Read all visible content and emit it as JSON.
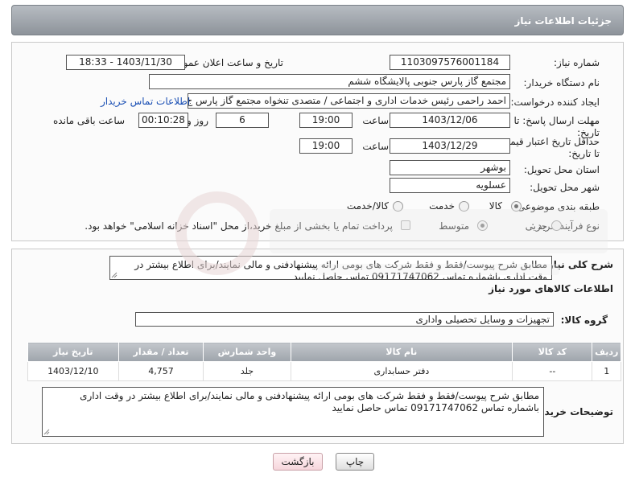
{
  "header": {
    "title": "جزئیات اطلاعات نیاز"
  },
  "form": {
    "need_number": {
      "label": "شماره نیاز:",
      "value": "1103097576001184"
    },
    "announce": {
      "label": "تاریخ و ساعت اعلان عمومی:",
      "value": "1403/11/30 - 18:33"
    },
    "buyer": {
      "label": "نام دستگاه خریدار:",
      "value": "مجتمع گاز پارس جنوبی  پالایشگاه ششم"
    },
    "creator": {
      "label": "ایجاد کننده درخواست:",
      "value": "احمد راحمی رئیس خدمات اداری و اجتماعی / متصدی تنخواه مجتمع گاز پارس ج",
      "link": "اطلاعات تماس خریدار"
    },
    "deadline": {
      "label": "مهلت ارسال پاسخ: تا تاریخ:",
      "date": "1403/12/06",
      "time_label": "ساعت",
      "time": "19:00",
      "days": "6",
      "days_label": "روز و",
      "remaining": "00:10:28",
      "remaining_label": "ساعت باقی مانده"
    },
    "validity": {
      "label": "حداقل تاریخ اعتبار قیمت: تا تاریخ:",
      "date": "1403/12/29",
      "time_label": "ساعت",
      "time": "19:00"
    },
    "province": {
      "label": "استان محل تحویل:",
      "value": "بوشهر"
    },
    "city": {
      "label": "شهر محل تحویل:",
      "value": "عسلویه"
    },
    "category": {
      "label": "طبقه بندی موضوعی:",
      "options": [
        "کالا",
        "خدمت",
        "کالا/خدمت"
      ],
      "selected": "کالا"
    },
    "process": {
      "label": "نوع فرآیند خرید :",
      "options": [
        "جزیی",
        "متوسط"
      ],
      "selected": "متوسط",
      "payment_note": "پرداخت تمام یا بخشی از مبلغ خرید،از محل \"اسناد خزانه اسلامی\" خواهد بود."
    }
  },
  "description": {
    "label": "شرح کلی نیاز:",
    "text": "مطابق شرح پیوست/فقط و فقط شرکت های بومی ارائه پیشنهادفنی و مالی نمایند/برای اطلاع بیشتر در وقت اداری  باشماره تماس 09171747062 تماس حاصل نمایید"
  },
  "goods": {
    "section_title": "اطلاعات کالاهای مورد نیاز",
    "group_label": "گروه کالا:",
    "group_value": "تجهیزات و وسایل تحصیلی واداری",
    "columns": [
      "ردیف",
      "کد کالا",
      "نام کالا",
      "واحد شمارش",
      "تعداد / مقدار",
      "تاریخ نیاز"
    ],
    "rows": [
      [
        "1",
        "--",
        "دفتر حسابداری",
        "جلد",
        "4,757",
        "1403/12/10"
      ]
    ]
  },
  "buyer_notes": {
    "label": "توضیحات خریدار:",
    "text": "مطابق شرح پیوست/فقط و فقط شرکت های بومی ارائه پیشنهادفنی و مالی نمایند/برای اطلاع بیشتر در وقت اداری  باشماره تماس 09171747062 تماس حاصل نمایید"
  },
  "buttons": {
    "print": "چاپ",
    "back": "بازگشت"
  },
  "colors": {
    "header_bg": "#9aa0a6",
    "link": "#1a4fb4",
    "back_bg": "#fde9ec"
  }
}
